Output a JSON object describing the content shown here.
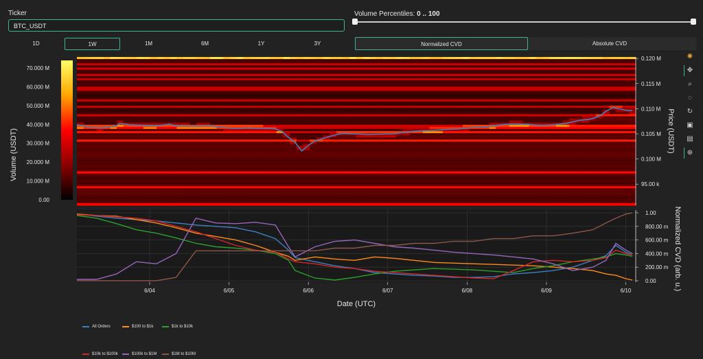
{
  "controls": {
    "ticker_label": "Ticker",
    "ticker_value": "BTC_USDT",
    "percentile_label": "Volume Percentiles: ",
    "percentile_value": "0 .. 100",
    "percentile_range": [
      0,
      100
    ],
    "timeframes": [
      "1D",
      "1W",
      "1M",
      "6M",
      "1Y",
      "3Y"
    ],
    "active_timeframe": "1W",
    "cvd_buttons": [
      "Normalized CVD",
      "Absolute CVD"
    ],
    "active_cvd": "Normalized CVD"
  },
  "toolbar": {
    "icons": [
      "logo-icon",
      "pan-icon",
      "zoom-icon",
      "lasso-icon",
      "reset-icon",
      "save-icon",
      "hover-icon",
      "crosshair-icon"
    ]
  },
  "chart_data": [
    {
      "type": "heatmap",
      "colorbar_title": "Volume (USDT)",
      "colorbar_ticks": [
        "0.00",
        "10.000 M",
        "20.000 M",
        "30.000 M",
        "40.000 M",
        "50.000 M",
        "60.000 M",
        "70.000 M"
      ],
      "colorbar_values": [
        0,
        10000000,
        20000000,
        30000000,
        40000000,
        50000000,
        60000000,
        70000000
      ],
      "colorbar_range": [
        0,
        74000000
      ],
      "colorscale": [
        "#000000",
        "#8b0000",
        "#ff0000",
        "#ffa500",
        "#ffff66"
      ],
      "y_title": "Price (USDT)",
      "y_ticks": [
        "95.00 k",
        "0.100 M",
        "0.105 M",
        "0.110 M",
        "0.115 M",
        "0.120 M"
      ],
      "y_tick_values": [
        95000,
        100000,
        105000,
        110000,
        115000,
        120000
      ],
      "ylim": [
        90800,
        120300
      ],
      "x_ticks": [
        "6/04",
        "6/05",
        "6/06",
        "6/07",
        "6/08",
        "6/09",
        "6/10"
      ],
      "xlim": [
        "2025-06-03T02:00",
        "2025-06-10T03:00"
      ],
      "series": [
        {
          "name": "Price",
          "color": "#3b82c4",
          "x_hours": [
            0,
            4,
            8,
            12,
            13,
            16,
            20,
            24,
            28,
            30,
            36,
            40,
            44,
            48,
            52,
            56,
            60,
            62,
            64,
            66,
            68,
            70,
            72,
            76,
            80,
            84,
            88,
            96,
            100,
            104,
            108,
            112,
            116,
            120,
            124,
            128,
            132,
            136,
            140,
            144,
            148,
            152,
            155,
            158,
            160,
            162,
            164,
            166,
            168
          ],
          "y": [
            106800,
            106300,
            106200,
            106600,
            107100,
            106800,
            106700,
            106600,
            106900,
            106600,
            106500,
            106600,
            106300,
            106100,
            106200,
            106100,
            106000,
            105500,
            104300,
            103300,
            101600,
            102700,
            103600,
            104400,
            105100,
            105000,
            104900,
            105000,
            105400,
            105600,
            105700,
            105900,
            106000,
            106300,
            106400,
            106800,
            107000,
            106900,
            106700,
            106800,
            107100,
            107700,
            107900,
            108500,
            109500,
            110200,
            110000,
            109700,
            109600
          ]
        }
      ]
    },
    {
      "type": "line",
      "y_title": "Normalized CVD (arb. u.)",
      "y_ticks": [
        "0.00",
        "200.00 m",
        "400.00 m",
        "600.00 m",
        "800.00 m",
        "1.00"
      ],
      "y_tick_values": [
        0,
        0.2,
        0.4,
        0.6,
        0.8,
        1.0
      ],
      "ylim": [
        -0.02,
        1.04
      ],
      "x_title": "Date (UTC)",
      "x_ticks": [
        "6/04",
        "6/05",
        "6/06",
        "6/07",
        "6/08",
        "6/09",
        "6/10"
      ],
      "xlim": [
        "2025-06-03T02:00",
        "2025-06-10T03:00"
      ],
      "x_hours": [
        0,
        6,
        12,
        18,
        24,
        30,
        36,
        42,
        48,
        54,
        60,
        64,
        66,
        72,
        78,
        84,
        90,
        96,
        102,
        108,
        114,
        120,
        126,
        132,
        138,
        144,
        150,
        156,
        160,
        163,
        166,
        168
      ],
      "series": [
        {
          "name": "All Orders",
          "color": "#3b82c4",
          "values": [
            0.98,
            0.95,
            0.92,
            0.9,
            0.88,
            0.85,
            0.82,
            0.8,
            0.78,
            0.72,
            0.62,
            0.45,
            0.34,
            0.28,
            0.22,
            0.18,
            0.12,
            0.1,
            0.08,
            0.07,
            0.05,
            0.05,
            0.06,
            0.1,
            0.12,
            0.15,
            0.2,
            0.3,
            0.37,
            0.52,
            0.42,
            0.38
          ]
        },
        {
          "name": "$100 to $1k",
          "color": "#ff8c1a",
          "values": [
            0.98,
            0.96,
            0.95,
            0.9,
            0.85,
            0.78,
            0.7,
            0.65,
            0.6,
            0.52,
            0.42,
            0.36,
            0.3,
            0.35,
            0.32,
            0.3,
            0.35,
            0.33,
            0.3,
            0.27,
            0.26,
            0.25,
            0.24,
            0.23,
            0.22,
            0.2,
            0.18,
            0.15,
            0.1,
            0.08,
            0.03,
            0.01
          ]
        },
        {
          "name": "$1k to $10k",
          "color": "#2ca02c",
          "values": [
            0.96,
            0.92,
            0.84,
            0.75,
            0.7,
            0.63,
            0.55,
            0.5,
            0.48,
            0.45,
            0.4,
            0.3,
            0.15,
            0.04,
            0.01,
            0.05,
            0.1,
            0.14,
            0.16,
            0.18,
            0.17,
            0.16,
            0.14,
            0.12,
            0.18,
            0.22,
            0.28,
            0.32,
            0.35,
            0.4,
            0.38,
            0.36
          ]
        },
        {
          "name": "$10k to $100k",
          "color": "#d62728",
          "values": [
            0.97,
            0.96,
            0.94,
            0.92,
            0.88,
            0.8,
            0.72,
            0.62,
            0.52,
            0.45,
            0.42,
            0.32,
            0.28,
            0.25,
            0.2,
            0.18,
            0.14,
            0.12,
            0.1,
            0.08,
            0.06,
            0.04,
            0.03,
            0.15,
            0.28,
            0.3,
            0.28,
            0.3,
            0.34,
            0.45,
            0.4,
            0.38
          ]
        },
        {
          "name": "$100k to $1M",
          "color": "#9467bd",
          "values": [
            0.02,
            0.02,
            0.1,
            0.28,
            0.25,
            0.4,
            0.92,
            0.85,
            0.84,
            0.86,
            0.82,
            0.5,
            0.35,
            0.5,
            0.58,
            0.6,
            0.55,
            0.5,
            0.48,
            0.45,
            0.42,
            0.4,
            0.38,
            0.35,
            0.32,
            0.25,
            0.15,
            0.2,
            0.3,
            0.55,
            0.45,
            0.4
          ]
        },
        {
          "name": "$1M to $10M",
          "color": "#8c564b",
          "values": [
            0.0,
            0.0,
            0.0,
            0.0,
            0.0,
            0.05,
            0.44,
            0.44,
            0.44,
            0.44,
            0.44,
            0.44,
            0.44,
            0.44,
            0.48,
            0.48,
            0.52,
            0.52,
            0.55,
            0.55,
            0.58,
            0.58,
            0.62,
            0.62,
            0.66,
            0.66,
            0.7,
            0.75,
            0.85,
            0.92,
            0.98,
            1.0
          ]
        }
      ]
    }
  ]
}
